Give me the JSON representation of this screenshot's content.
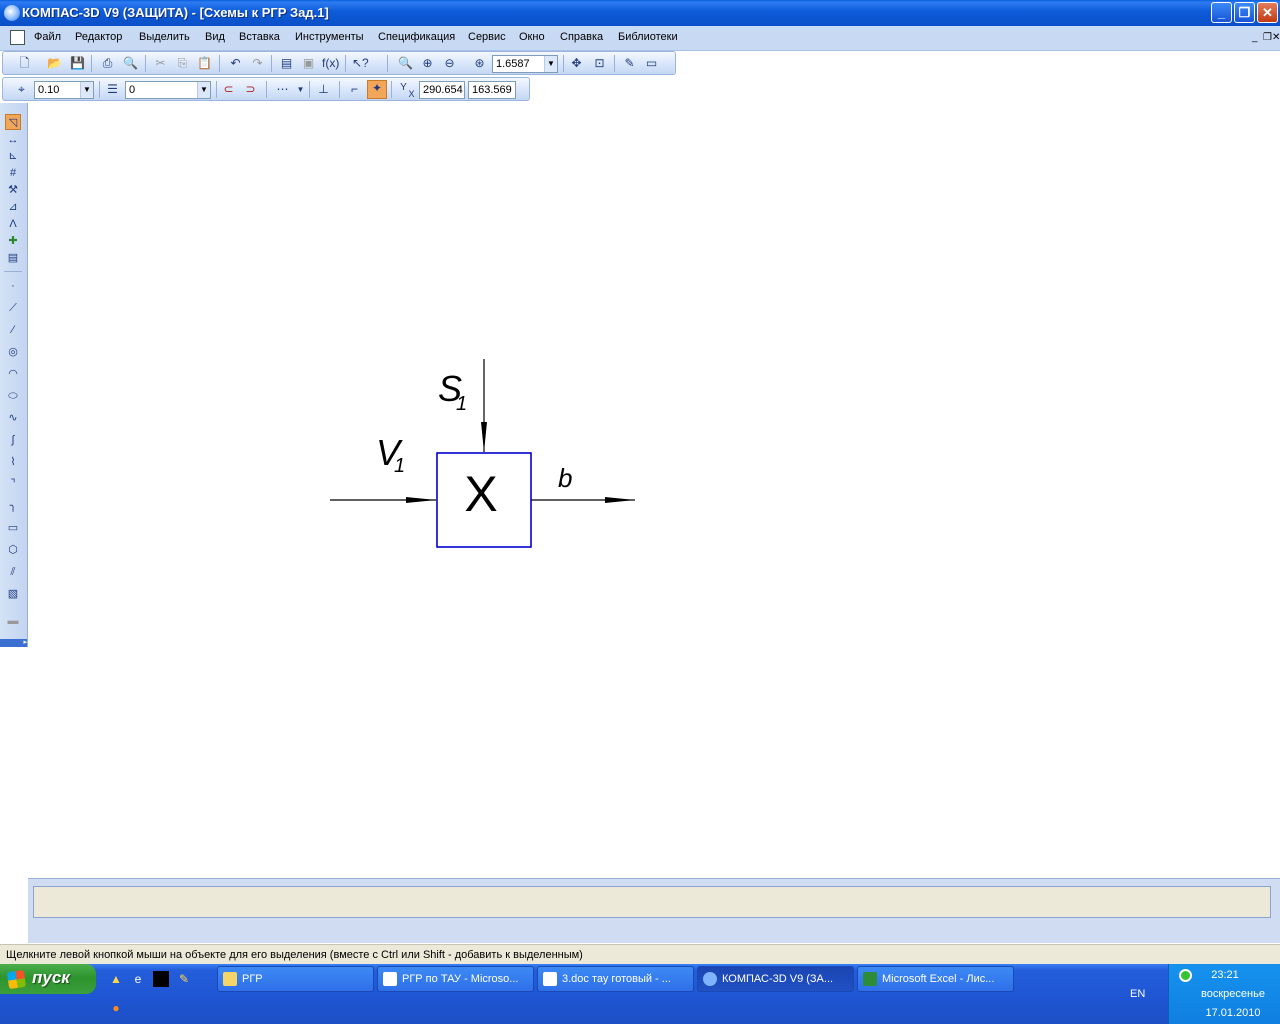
{
  "window": {
    "title": "КОМПАС-3D V9 (ЗАЩИТА) - [Схемы к РГР Зад.1]",
    "buttons": {
      "minimize": "_",
      "restore": "❐",
      "close": "✕"
    }
  },
  "menu": {
    "items": [
      "Файл",
      "Редактор",
      "Выделить",
      "Вид",
      "Вставка",
      "Инструменты",
      "Спецификация",
      "Сервис",
      "Окно",
      "Справка",
      "Библиотеки"
    ],
    "mdi_buttons": [
      "_",
      "❐",
      "✕"
    ]
  },
  "toolbar_standard": {
    "zoom_value": "1.6587"
  },
  "toolbar_current_state": {
    "step": "0.10",
    "layer": "0",
    "coord_x_label": "Y",
    "coord_y_label": "X",
    "coord_x": "290.654",
    "coord_y": "163.569"
  },
  "drawing": {
    "block_label": "X",
    "input_label": "V",
    "input_sub": "1",
    "disturbance_label": "S",
    "disturbance_sub": "1",
    "output_label": "b",
    "block_color": "#0000cc",
    "line_color": "#000000"
  },
  "status_bar": {
    "hint": "Щелкните левой кнопкой мыши на объекте для его выделения (вместе с Ctrl или Shift - добавить к выделенным)"
  },
  "taskbar": {
    "start_label": "пуск",
    "tasks": [
      {
        "label": "РГР",
        "icon": "folder-icon",
        "color": "#f5d46a"
      },
      {
        "label": "РГР по ТАУ - Microso...",
        "icon": "word-icon",
        "color": "#ffffff"
      },
      {
        "label": "3.doc тау готовый - ...",
        "icon": "word-icon",
        "color": "#ffffff"
      },
      {
        "label": "КОМПАС-3D V9 (ЗА...",
        "icon": "kompas-icon",
        "color": "#7fb3ff"
      },
      {
        "label": "Microsoft Excel - Лис...",
        "icon": "excel-icon",
        "color": "#2e8b3a"
      }
    ],
    "language": "EN",
    "clock_time": "23:21",
    "clock_day": "воскресенье",
    "clock_date": "17.01.2010"
  }
}
